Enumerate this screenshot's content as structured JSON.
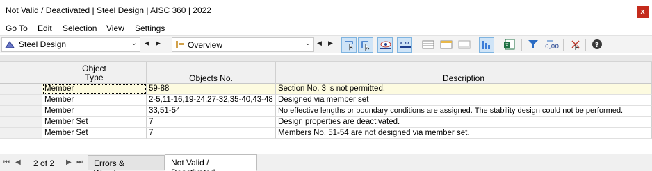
{
  "window": {
    "title": "Not Valid / Deactivated | Steel Design | AISC 360 | 2022",
    "close_glyph": "x"
  },
  "menu": [
    "Go To",
    "Edit",
    "Selection",
    "View",
    "Settings"
  ],
  "toolbar": {
    "module_combo": {
      "label": "Steel Design",
      "icon": "steel-design-icon"
    },
    "view_combo": {
      "label": "Overview",
      "icon": "overview-icon"
    },
    "nav_prev": "◀",
    "nav_next": "▶",
    "dropdown_glyph": "⌄",
    "buttons": [
      "select-objects-icon",
      "show-objects-icon",
      "visibility-icon",
      "table-values-icon",
      "table-icon",
      "table-insert-icon",
      "table-remove-icon",
      "column-chart-icon",
      "excel-export-icon",
      "filter-icon",
      "decimal-places-icon",
      "clear-filter-icon",
      "help-icon"
    ]
  },
  "table": {
    "columns": [
      "Object\nType",
      "Objects No.",
      "Description"
    ],
    "rows": [
      {
        "type": "Member",
        "objects": "59-88",
        "description": "Section No. 3 is not permitted."
      },
      {
        "type": "Member",
        "objects": "2-5,11-16,19-24,27-32,35-40,43-48",
        "description": "Designed via member set"
      },
      {
        "type": "Member",
        "objects": "33,51-54",
        "description": "No effective lengths or boundary conditions are assigned. The stability design could not be performed."
      },
      {
        "type": "Member Set",
        "objects": "7",
        "description": "Design properties are deactivated."
      },
      {
        "type": "Member Set",
        "objects": "7",
        "description": "Members No. 51-54 are not designed via member set."
      }
    ],
    "selected_row": 0
  },
  "pager": {
    "info": "2 of 2",
    "first": "⏮",
    "prev": "◀",
    "next": "▶",
    "last": "⏭"
  },
  "tabs": [
    {
      "label": "Errors & Warnings",
      "active": false
    },
    {
      "label": "Not Valid / Deactivated",
      "active": true
    }
  ],
  "colors": {
    "selected_row": "#fdfbe0",
    "accent": "#1e6fcf",
    "close": "#c42b1c"
  }
}
